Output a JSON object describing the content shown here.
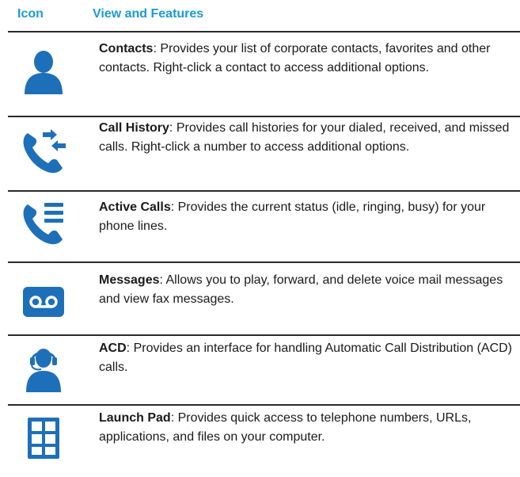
{
  "header": {
    "icon_col": "Icon",
    "features_col": "View and Features"
  },
  "colors": {
    "header_text": "#1a9ad6",
    "icon_blue": "#1e6fb9",
    "rule": "#2a2a2a"
  },
  "rows": [
    {
      "icon": "contacts-person-icon",
      "title": "Contacts",
      "text": ": Provides your list of corporate contacts, favorites and other contacts. Right-click a contact to access additional options."
    },
    {
      "icon": "call-history-icon",
      "title": "Call History",
      "text": ": Provides call histories for your dialed, received, and missed calls. Right-click a number to access additional options."
    },
    {
      "icon": "active-calls-icon",
      "title": "Active Calls",
      "text": ": Provides the current status (idle, ringing, busy) for your phone lines."
    },
    {
      "icon": "voicemail-icon",
      "title": "Messages",
      "text": ": Allows you to play, forward, and delete voice mail messages and view fax messages."
    },
    {
      "icon": "acd-headset-agent-icon",
      "title": "ACD",
      "text": ": Provides an interface for handling Automatic Call Distribution (ACD) calls."
    },
    {
      "icon": "launch-pad-grid-icon",
      "title": "Launch Pad",
      "text": ": Provides quick access to telephone numbers, URLs, applications, and files on your computer."
    }
  ]
}
